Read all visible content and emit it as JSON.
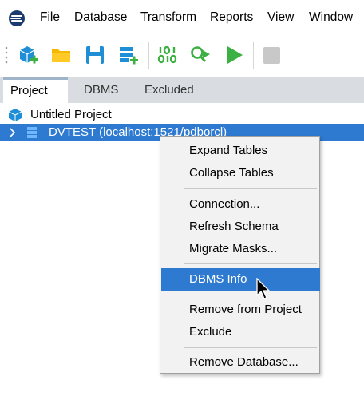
{
  "menubar": {
    "items": [
      "File",
      "Database",
      "Transform",
      "Reports",
      "View",
      "Window"
    ]
  },
  "toolbar": {
    "buttons": [
      {
        "name": "new-project",
        "icon": "cube-plus-icon"
      },
      {
        "name": "open",
        "icon": "folder-icon"
      },
      {
        "name": "save",
        "icon": "floppy-disk-icon"
      },
      {
        "name": "add-database",
        "icon": "database-plus-icon"
      },
      {
        "name": "binary",
        "icon": "binary-icon"
      },
      {
        "name": "search-run",
        "icon": "magnifier-play-icon"
      },
      {
        "name": "run",
        "icon": "play-icon"
      },
      {
        "name": "stop",
        "icon": "stop-icon"
      }
    ]
  },
  "tabs": [
    {
      "label": "Project",
      "active": true
    },
    {
      "label": "DBMS",
      "active": false
    },
    {
      "label": "Excluded",
      "active": false
    }
  ],
  "tree": {
    "project": "Untitled Project",
    "database": "DVTEST (localhost:1521/pdborcl)"
  },
  "context_menu": {
    "groups": [
      [
        "Expand Tables",
        "Collapse Tables"
      ],
      [
        "Connection...",
        "Refresh Schema",
        "Migrate Masks..."
      ],
      [
        "DBMS Info"
      ],
      [
        "Remove from Project",
        "Exclude"
      ],
      [
        "Remove Database..."
      ]
    ],
    "highlighted": "DBMS Info"
  },
  "colors": {
    "selection": "#2e7ad1",
    "tab_bar": "#d9dde2",
    "menu_bg": "#f2f2f2",
    "accent_blue": "#1e8fd6",
    "accent_green": "#3cb043",
    "folder_yellow": "#f5b800"
  }
}
